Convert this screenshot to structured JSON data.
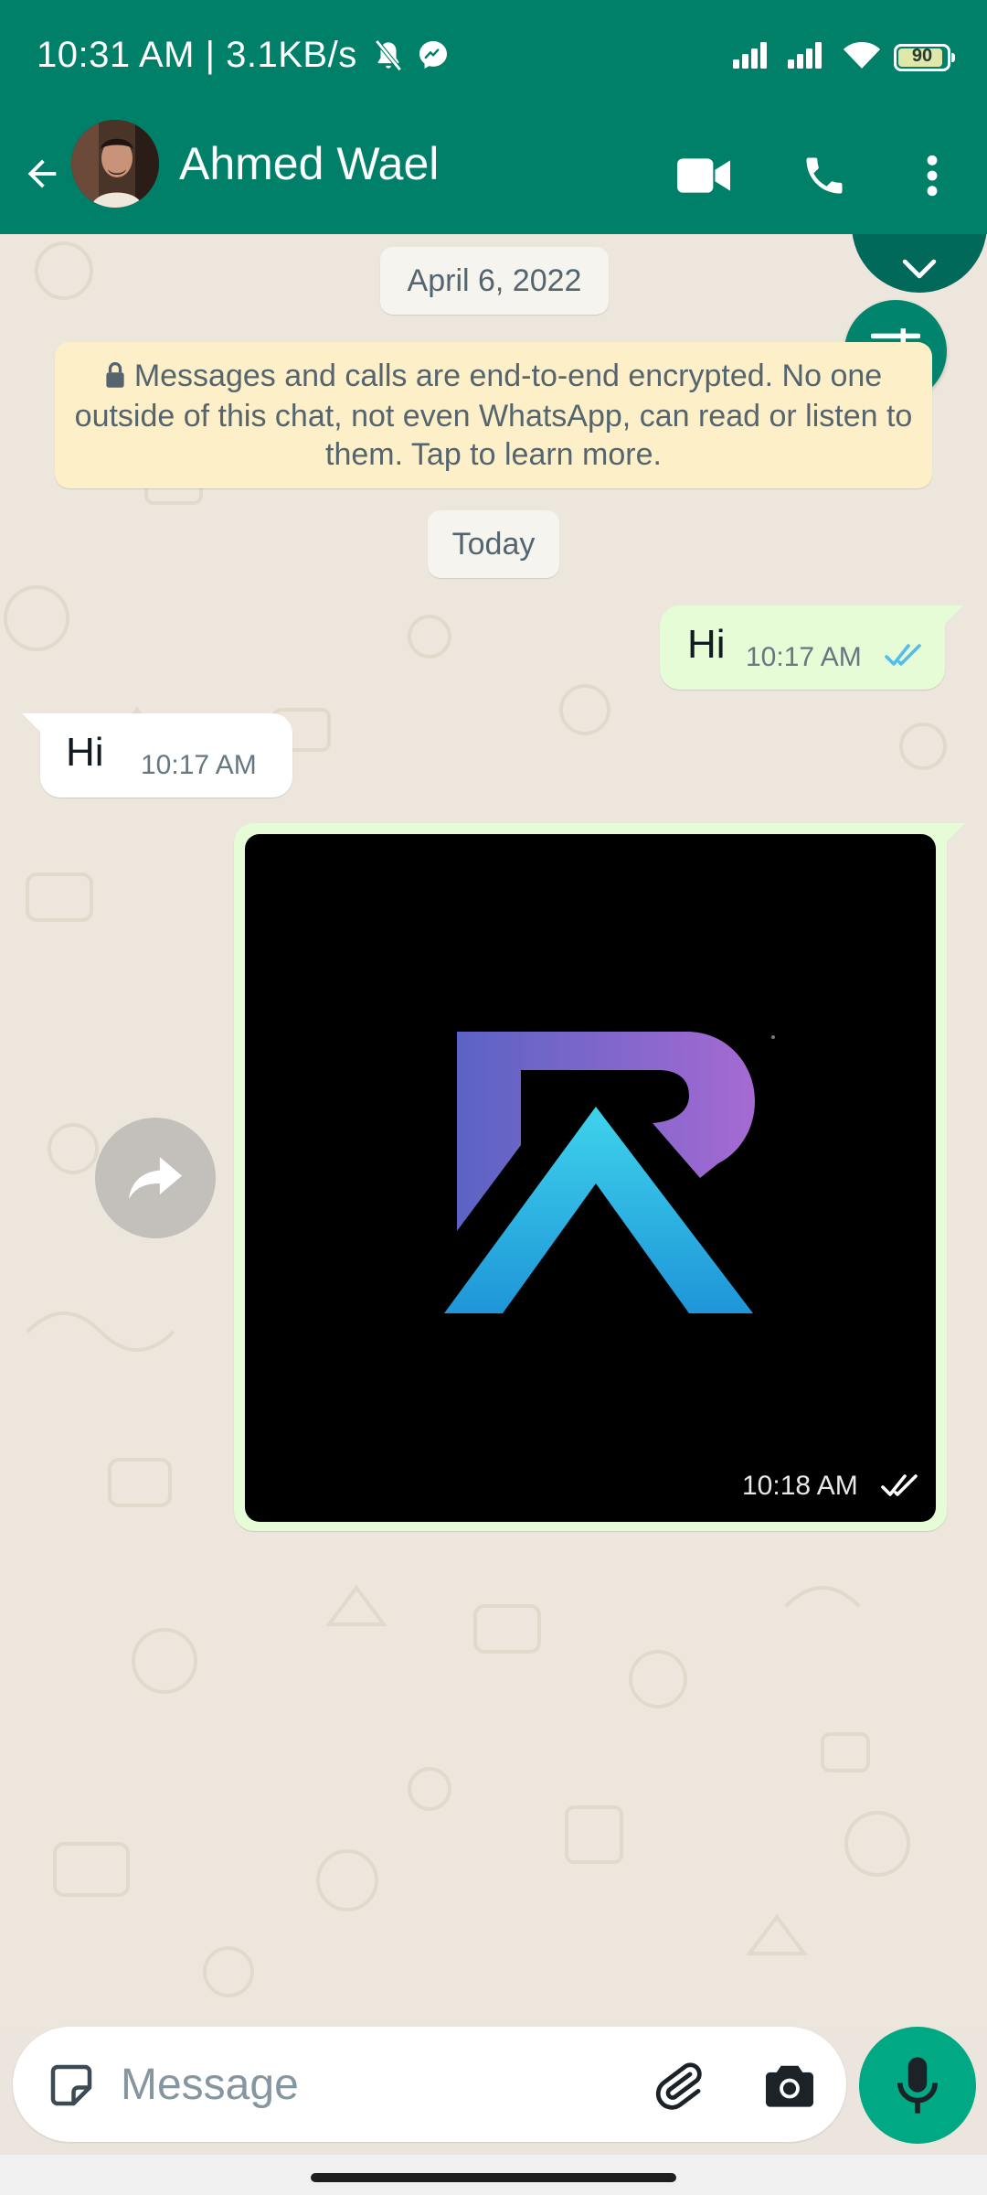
{
  "status_bar": {
    "time_and_speed": "10:31 AM | 3.1KB/s",
    "battery_level": "90",
    "icons": [
      "bell-muted-icon",
      "messenger-icon",
      "signal-icon",
      "signal-icon",
      "wifi-icon",
      "battery-icon"
    ]
  },
  "header": {
    "back_icon": "arrow-left-icon",
    "contact_name": "Ahmed Wael",
    "actions": [
      "video-call-icon",
      "voice-call-icon",
      "more-vert-icon"
    ]
  },
  "chat": {
    "date_pill": "April 6, 2022",
    "encryption_notice": "Messages and calls are end-to-end encrypted. No one outside of this chat, not even WhatsApp, can read or listen to them. Tap to learn more.",
    "today_pill": "Today",
    "messages": [
      {
        "direction": "outgoing",
        "text": "Hi",
        "time": "10:17 AM",
        "status": "read"
      },
      {
        "direction": "incoming",
        "text": "Hi",
        "time": "10:17 AM"
      },
      {
        "direction": "outgoing",
        "type": "image",
        "time": "10:18 AM",
        "status": "delivered"
      }
    ]
  },
  "composer": {
    "placeholder": "Message",
    "icons": [
      "sticker-icon",
      "attach-icon",
      "camera-icon",
      "mic-icon"
    ]
  },
  "colors": {
    "header": "#008069",
    "outgoing_bubble": "#e6fcd6",
    "incoming_bubble": "#ffffff",
    "read_tick": "#53bdeb",
    "mic_button": "#00a884",
    "encryption_bg": "#fdefc8"
  }
}
